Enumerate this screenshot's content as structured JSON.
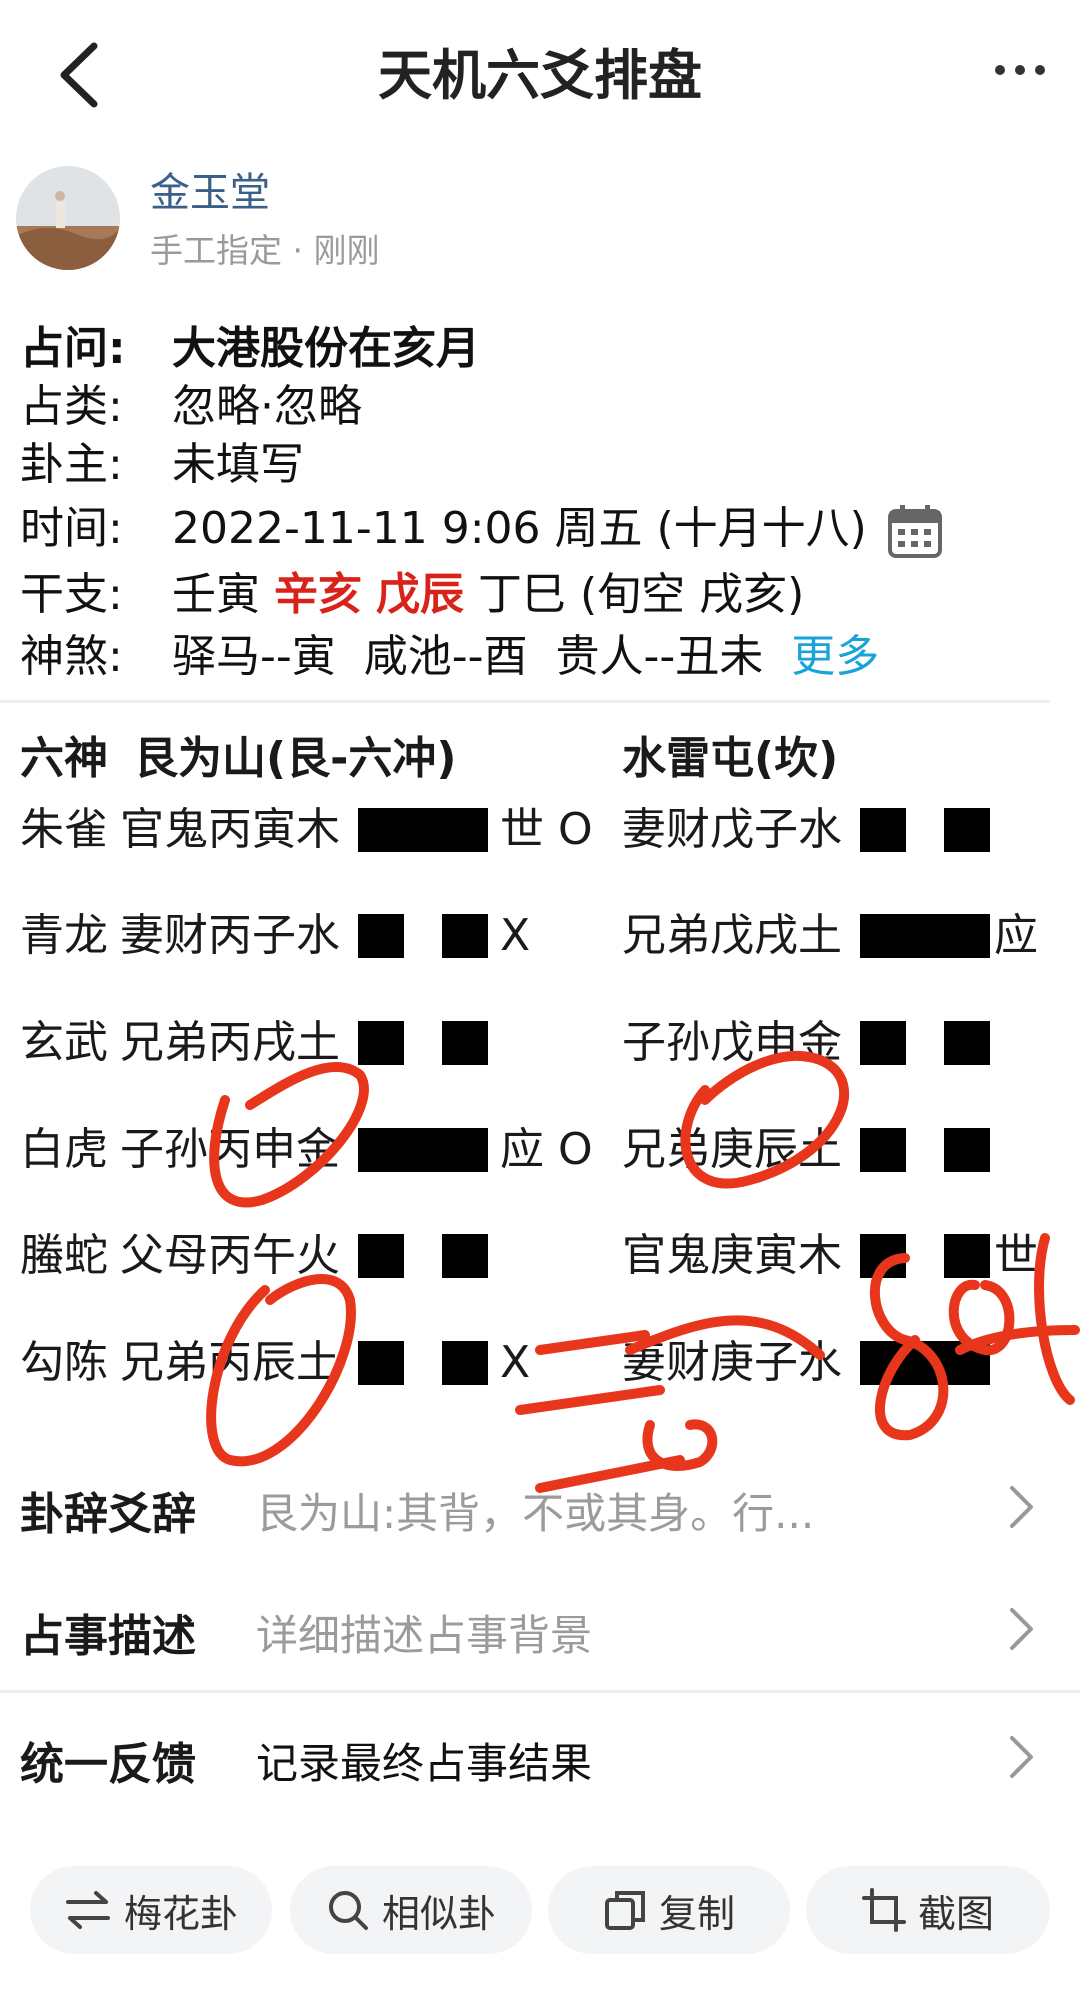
{
  "header": {
    "title": "天机六爻排盘"
  },
  "author": {
    "name": "金玉堂",
    "meta": "手工指定 · 刚刚"
  },
  "info": {
    "question_label": "占问:",
    "question": "大港股份在亥月",
    "category_label": "占类:",
    "category": "忽略·忽略",
    "owner_label": "卦主:",
    "owner": "未填写",
    "time_label": "时间:",
    "time": "2022-11-11 9:06 周五 (十月十八)",
    "ganzhi_label": "干支:",
    "gz1": "壬寅",
    "gz2": "辛亥",
    "gz3": "戊辰",
    "gz4": "丁巳 (旬空 戌亥)",
    "shensha_label": "神煞:",
    "shensha": "驿马--寅  咸池--酉  贵人--丑未",
    "more": "更多"
  },
  "gua": {
    "col_liushen": "六神",
    "main_name": "艮为山(艮-六冲)",
    "changed_name": "水雷屯(坎)",
    "rows": [
      {
        "shen": "朱雀",
        "left": "官鬼丙寅木",
        "left_type": "yang",
        "mark": "世 O",
        "right": "妻财戊子水",
        "right_type": "yin",
        "right_mark": ""
      },
      {
        "shen": "青龙",
        "left": "妻财丙子水",
        "left_type": "yin",
        "mark": "X",
        "right": "兄弟戊戌土",
        "right_type": "yang",
        "right_mark": "应"
      },
      {
        "shen": "玄武",
        "left": "兄弟丙戌土",
        "left_type": "yin",
        "mark": "",
        "right": "子孙戊申金",
        "right_type": "yin",
        "right_mark": ""
      },
      {
        "shen": "白虎",
        "left": "子孙丙申金",
        "left_type": "yang",
        "mark": "应 O",
        "right": "兄弟庚辰土",
        "right_type": "yin",
        "right_mark": ""
      },
      {
        "shen": "螣蛇",
        "left": "父母丙午火",
        "left_type": "yin",
        "mark": "",
        "right": "官鬼庚寅木",
        "right_type": "yin",
        "right_mark": "世"
      },
      {
        "shen": "勾陈",
        "left": "兄弟丙辰土",
        "left_type": "yin",
        "mark": "X",
        "right": "妻财庚子水",
        "right_type": "yang",
        "right_mark": ""
      }
    ]
  },
  "list": {
    "guaci_label": "卦辞爻辞",
    "guaci_value": "艮为山:其背，不或其身。行...",
    "desc_label": "占事描述",
    "desc_value": "详细描述占事背景",
    "feedback_label": "统一反馈",
    "feedback_value": "记录最终占事结果"
  },
  "bottom": {
    "meihua": "梅花卦",
    "similar": "相似卦",
    "copy": "复制",
    "screenshot": "截图"
  },
  "colors": {
    "accent_red": "#d8231a",
    "link_blue": "#1aa3d6",
    "scribble": "#e8361c"
  }
}
